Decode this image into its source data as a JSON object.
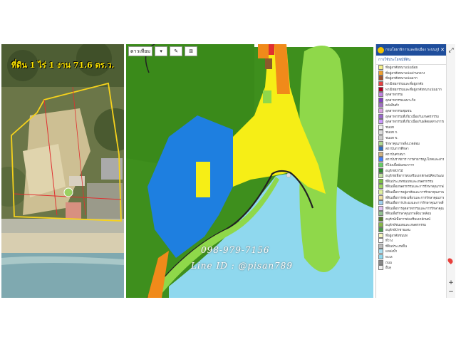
{
  "satellite": {
    "title": "ที่ดิน 1 ไร่ 1 งาน 71.6 ตร.ว."
  },
  "map": {
    "toolbar": {
      "layers_label": "ดาวเทียม",
      "btn2": "▾",
      "btn3": "✎",
      "btn4": "⊞"
    },
    "phone": "098-979-7156",
    "line_id": "Line ID : @pisan789"
  },
  "legend": {
    "header_title": "กรมโยธาธิการและผังเมือง ระบบภูมิสารสนเทศ",
    "close": "✕",
    "subheader": "การใช้ประโยชน์ที่ดิน",
    "items": [
      {
        "label": "ที่อยู่อาศัยหนาแน่นน้อย",
        "color": "#f5f08a"
      },
      {
        "label": "ที่อยู่อาศัยหนาแน่นปานกลาง",
        "color": "#f0a030"
      },
      {
        "label": "ที่อยู่อาศัยหนาแน่นมาก",
        "color": "#a0522d"
      },
      {
        "label": "พาณิชยกรรมและที่อยู่อาศัย",
        "color": "#e84040"
      },
      {
        "label": "พาณิชยกรรมและที่อยู่อาศัยหนาแน่นมาก",
        "color": "#b00020"
      },
      {
        "label": "อุตสาหกรรม",
        "color": "#c080e0"
      },
      {
        "label": "อุตสาหกรรมเฉพาะกิจ",
        "color": "#8040c0"
      },
      {
        "label": "คลังสินค้า",
        "color": "#a070c0"
      },
      {
        "label": "อุตสาหกรรมชุมชน",
        "color": "#d8a0e0"
      },
      {
        "label": "อุตสาหกรรมที่เกี่ยวเนื่องกับเกษตรกรรม",
        "color": "#9966cc"
      },
      {
        "label": "อุตสาหกรรมที่เกี่ยวเนื่องกับผลิตผลทางการเกษตร",
        "color": "#cc99ff"
      },
      {
        "label": "ชนบท",
        "color": "#f0f0f0"
      },
      {
        "label": "ชนบท ก.",
        "color": "#dddddd"
      },
      {
        "label": "ชนบท ข.",
        "color": "#cccccc"
      },
      {
        "label": "รักษาคุณภาพสิ่งแวดล้อม",
        "color": "#b0d890"
      },
      {
        "label": "สถาบันการศึกษา",
        "color": "#3070c0"
      },
      {
        "label": "สถาบันศาสนา",
        "color": "#d0b080"
      },
      {
        "label": "สถาบันราชการ การสาธารณูปโภคและสาธารณูปการ",
        "color": "#4080ff"
      },
      {
        "label": "ที่โล่งเพื่อนันทนาการ",
        "color": "#66cc66"
      },
      {
        "label": "อนุรักษ์ป่าไม้",
        "color": "#2e8b2e"
      },
      {
        "label": "อนุรักษ์เพื่อการส่งเสริมเอกลักษณ์ศิลปวัฒนธรรม",
        "color": "#c0e0a0"
      },
      {
        "label": "ที่ดินประเภทชนบทและเกษตรกรรม",
        "color": "#7ac043"
      },
      {
        "label": "ที่ดินเพื่อเกษตรกรรมและการรักษาคุณภาพสิ่งแวดล้อม",
        "color": "#9fd860"
      },
      {
        "label": "ที่ดินเพื่อการอยู่อาศัยและการรักษาคุณภาพสิ่งแวดล้อม",
        "color": "#e0f0a0"
      },
      {
        "label": "ที่ดินเพื่อการท่องเที่ยวและการรักษาคุณภาพสิ่งแวดล้อม",
        "color": "#f0e0a0"
      },
      {
        "label": "ที่ดินเพื่อการประมงและการรักษาคุณภาพสิ่งแวดล้อม",
        "color": "#a0d0f0"
      },
      {
        "label": "ที่ดินเพื่อการอุตสาหกรรมและการรักษาคุณภาพสิ่งแวดล้อม",
        "color": "#e0c0f0"
      },
      {
        "label": "ที่ดินเพื่อรักษาคุณภาพสิ่งแวดล้อม",
        "color": "#90c090"
      },
      {
        "label": "อนุรักษ์เพื่อการส่งเสริมเอกลักษณ์",
        "color": "#557a30"
      },
      {
        "label": "อนุรักษ์ชนบทและเกษตรกรรม",
        "color": "#88b848"
      },
      {
        "label": "อนุรักษ์ป่าชายเลน",
        "color": "#4a9a4a"
      },
      {
        "label": "ที่อยู่อาศัยชนบท",
        "color": "#f8f8c0"
      },
      {
        "label": "ที่ว่าง",
        "color": "#ffffff"
      },
      {
        "label": "ที่ดินประเภทอื่น",
        "color": "#bbbbbb"
      },
      {
        "label": "แหล่งน้ำ",
        "color": "#a8dff0"
      },
      {
        "label": "ทะเล",
        "color": "#8fd8ee"
      },
      {
        "label": "ถนน",
        "color": "#888888"
      },
      {
        "label": "อื่นๆ",
        "color": "#eeeeee"
      }
    ]
  },
  "controls": {
    "zoom_in": "+",
    "zoom_out": "−",
    "nav": "✥"
  },
  "colors": {
    "forest": "#3e8f1d",
    "water": "#8fd8ee",
    "lake_blue": "#1e7fe0",
    "residential_yellow": "#f6ee16",
    "agriculture": "#8fd84a",
    "orange": "#f08a1a",
    "parcel_outline": "#f6d21c",
    "legend_header": "#1f4e9c"
  }
}
